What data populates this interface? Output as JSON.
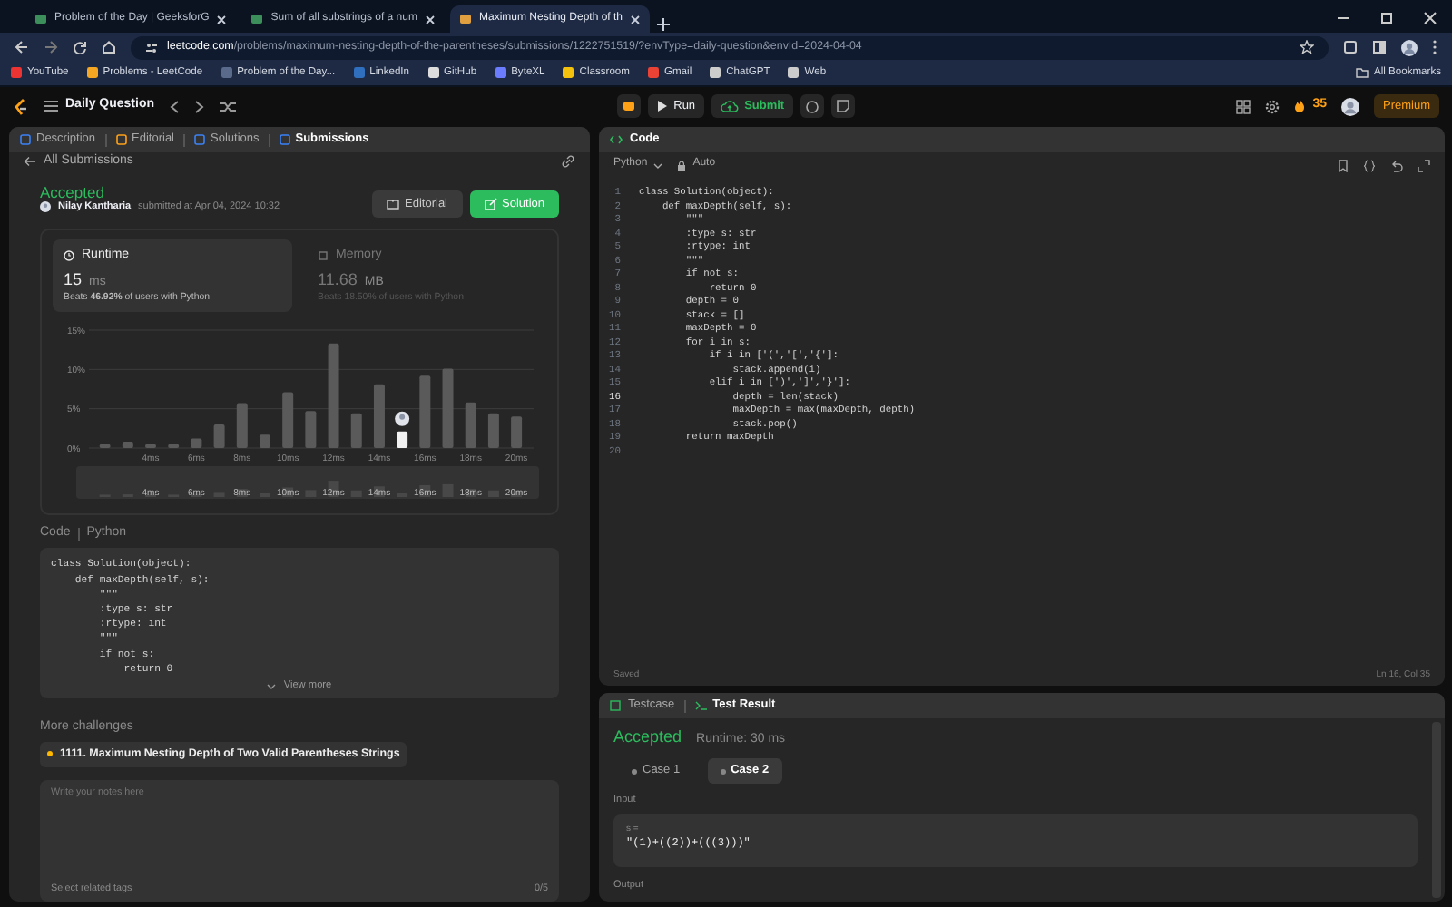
{
  "browser": {
    "tabs": [
      {
        "title": "Problem of the Day | GeeksforG",
        "selected": false
      },
      {
        "title": "Sum of all substrings of a num",
        "selected": false
      },
      {
        "title": "Maximum Nesting Depth of th",
        "selected": true
      }
    ],
    "url": {
      "host": "leetcode.com",
      "path": "/problems/maximum-nesting-depth-of-the-parentheses/submissions/1222751519/?envType=daily-question&envId=2024-04-04"
    },
    "bookmarks": [
      "YouTube",
      "Problems - LeetCode",
      "Problem of the Day...",
      "LinkedIn",
      "GitHub",
      "ByteXL",
      "Classroom",
      "Gmail",
      "ChatGPT",
      "Web"
    ],
    "all_bookmarks": "All Bookmarks"
  },
  "app_nav": {
    "title": "Daily Question",
    "run": "Run",
    "submit": "Submit",
    "streak": "35",
    "premium": "Premium"
  },
  "left_panel": {
    "tabs": [
      {
        "label": "Description",
        "selected": false
      },
      {
        "label": "Editorial",
        "selected": false
      },
      {
        "label": "Solutions",
        "selected": false
      },
      {
        "label": "Submissions",
        "selected": true
      }
    ],
    "back_link": "All Submissions",
    "submission": {
      "status": "Accepted",
      "author": "Nilay Kantharia",
      "submitted_at": "submitted at Apr 04, 2024 10:32",
      "buttons": [
        {
          "label": "Editorial",
          "kind": "secondary"
        },
        {
          "label": "Solution",
          "kind": "primary"
        }
      ],
      "metrics": [
        {
          "label": "Runtime",
          "value": "15",
          "unit": "ms",
          "beats": "Beats **46.92%** of users with Python",
          "selected": true
        },
        {
          "label": "Memory",
          "value": "11.68",
          "unit": "MB",
          "beats": "Beats 18.50% of users with Python",
          "selected": false
        }
      ],
      "chart_data": {
        "type": "bar",
        "x": [
          2,
          3,
          4,
          5,
          6,
          7,
          8,
          9,
          10,
          11,
          12,
          13,
          14,
          15,
          16,
          17,
          18,
          19,
          20
        ],
        "series": [
          {
            "color": "#5a5a5a",
            "values": [
              0.5,
              0.8,
              0.5,
              0.5,
              1.2,
              3.0,
              5.7,
              1.7,
              7.1,
              4.7,
              13.3,
              4.4,
              8.1,
              null,
              9.2,
              10.1,
              5.8,
              4.4,
              4.0
            ]
          },
          {
            "color": "#f2f2f2",
            "values": [
              null,
              null,
              null,
              null,
              null,
              null,
              null,
              null,
              null,
              null,
              null,
              null,
              null,
              2.1,
              null,
              null,
              null,
              null,
              null
            ]
          }
        ],
        "xlim": [
          1.3,
          20.75
        ],
        "ylim": [
          0,
          15
        ],
        "yticks": [
          {
            "value": 0,
            "label": "0%"
          },
          {
            "value": 5,
            "label": "5%"
          },
          {
            "value": 10,
            "label": "10%"
          },
          {
            "value": 15,
            "label": "15%"
          }
        ],
        "xticks": [
          {
            "value": 4,
            "label": "4ms"
          },
          {
            "value": 6,
            "label": "6ms"
          },
          {
            "value": 8,
            "label": "8ms"
          },
          {
            "value": 10,
            "label": "10ms"
          },
          {
            "value": 12,
            "label": "12ms"
          },
          {
            "value": 14,
            "label": "14ms"
          },
          {
            "value": 16,
            "label": "16ms"
          },
          {
            "value": 18,
            "label": "18ms"
          },
          {
            "value": 20,
            "label": "20ms"
          }
        ]
      },
      "overview_labels": [
        "4ms",
        "6ms",
        "8ms",
        "10ms",
        "12ms",
        "14ms",
        "16ms",
        "18ms",
        "20ms"
      ]
    },
    "code_section": {
      "label": "Code",
      "language": "Python",
      "lines": [
        "class Solution(object):",
        "    def maxDepth(self, s):",
        "        \"\"\"",
        "        :type s: str",
        "        :rtype: int",
        "        \"\"\"",
        "        if not s:",
        "            return 0"
      ],
      "view_more": "View more"
    },
    "more_challenges": {
      "title": "More challenges",
      "items": [
        "1111. Maximum Nesting Depth of Two Valid Parentheses Strings"
      ]
    },
    "notes": {
      "placeholder": "Write your notes here",
      "tags_placeholder": "Select related tags",
      "tag_count": "0/5"
    }
  },
  "editor": {
    "title": "Code",
    "language": "Python",
    "mode": "Auto",
    "lines": [
      {
        "number": "1",
        "code": "class Solution(object):",
        "current": false
      },
      {
        "number": "2",
        "code": "    def maxDepth(self, s):",
        "current": false
      },
      {
        "number": "3",
        "code": "        \"\"\"",
        "current": false
      },
      {
        "number": "4",
        "code": "        :type s: str",
        "current": false
      },
      {
        "number": "5",
        "code": "        :rtype: int",
        "current": false
      },
      {
        "number": "6",
        "code": "        \"\"\"",
        "current": false
      },
      {
        "number": "7",
        "code": "        if not s:",
        "current": false
      },
      {
        "number": "8",
        "code": "            return 0",
        "current": false
      },
      {
        "number": "9",
        "code": "        depth = 0",
        "current": false
      },
      {
        "number": "10",
        "code": "        stack = []",
        "current": false
      },
      {
        "number": "11",
        "code": "        maxDepth = 0",
        "current": false
      },
      {
        "number": "12",
        "code": "        for i in s:",
        "current": false
      },
      {
        "number": "13",
        "code": "            if i in ['(','[','{']:",
        "current": false
      },
      {
        "number": "14",
        "code": "                stack.append(i)",
        "current": false
      },
      {
        "number": "15",
        "code": "            elif i in [')',']','}']:",
        "current": false
      },
      {
        "number": "16",
        "code": "                depth = len(stack)",
        "current": true
      },
      {
        "number": "17",
        "code": "                maxDepth = max(maxDepth, depth)",
        "current": false
      },
      {
        "number": "18",
        "code": "                stack.pop()",
        "current": false
      },
      {
        "number": "19",
        "code": "        return maxDepth",
        "current": false
      },
      {
        "number": "20",
        "current": false
      }
    ],
    "status": "Saved",
    "cursor": "Ln 16, Col 35"
  },
  "test_panel": {
    "tabs": [
      {
        "label": "Testcase",
        "selected": false
      },
      {
        "label": "Test Result",
        "selected": true
      }
    ],
    "status": "Accepted",
    "runtime": "Runtime: 30 ms",
    "cases": [
      {
        "label": "Case 1",
        "selected": false
      },
      {
        "label": "Case 2",
        "selected": true
      }
    ],
    "input_label": "Input",
    "params": [
      {
        "name": "s =",
        "value": "\"(1)+((2))+(((3)))\""
      }
    ],
    "output_label": "Output"
  }
}
